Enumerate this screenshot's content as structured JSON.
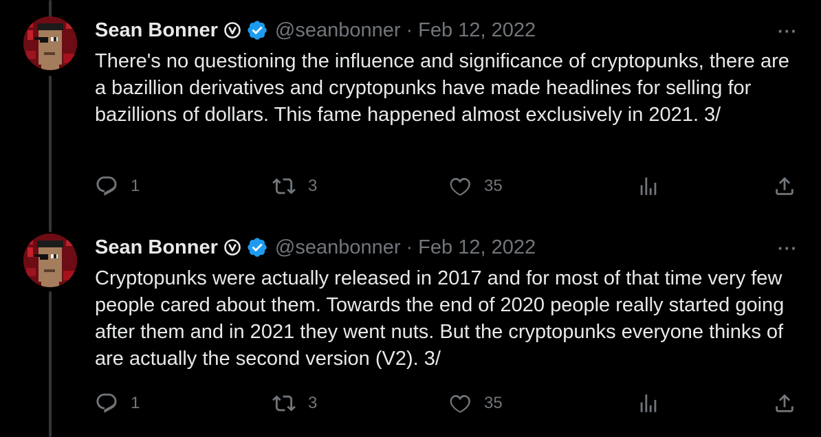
{
  "tweets": [
    {
      "name": "Sean Bonner",
      "handle": "@seanbonner",
      "separator": "·",
      "date": "Feb 12, 2022",
      "text": "There's no questioning the influence and significance of cryptopunks, there are a bazillion derivatives and cryptopunks have made headlines for selling for bazillions of dollars. This fame happened almost exclusively in 2021. 3/",
      "replies": "1",
      "retweets": "3",
      "likes": "35"
    },
    {
      "name": "Sean Bonner",
      "handle": "@seanbonner",
      "separator": "·",
      "date": "Feb 12, 2022",
      "text": "Cryptopunks were actually released in 2017 and for most of that time very few people cared about them. Towards the end of 2020 people really started going after them and in 2021 they went nuts. But the cryptopunks everyone thinks of are actually the second version (V2). 3/",
      "replies": "1",
      "retweets": "3",
      "likes": "35"
    }
  ],
  "more_label": "···",
  "icons": {
    "reply": "reply-icon",
    "retweet": "retweet-icon",
    "like": "like-icon",
    "views": "views-icon",
    "share": "share-icon",
    "verified": "verified-icon",
    "badge": "circle-v-badge-icon"
  },
  "colors": {
    "background": "#000000",
    "text": "#e7e9ea",
    "muted": "#71767b",
    "verified": "#1d9bf0"
  }
}
